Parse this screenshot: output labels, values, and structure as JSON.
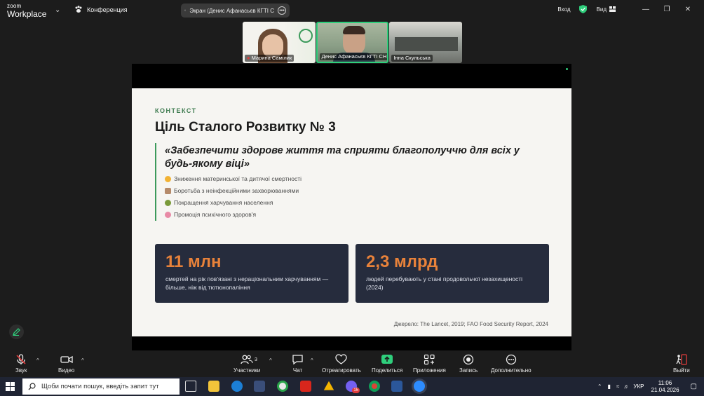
{
  "app": {
    "logo_line1": "zoom",
    "logo_line2": "Workplace",
    "conference_label": "Конференция",
    "screen_share_label": "Экран (Денис Афанасьєв КГТІ С",
    "entry_label": "Вход",
    "view_label": "Вид"
  },
  "participants": [
    {
      "name": "Марина Самілик",
      "muted": true
    },
    {
      "name": "Денис Афанасьєв КГТІ СН...",
      "active": true
    },
    {
      "name": "Інна Скульська"
    }
  ],
  "slide": {
    "kicker": "КОНТЕКСТ",
    "title": "Ціль Сталого Розвитку № 3",
    "quote": "«Забезпечити здорове життя та сприяти благополуччю для всіх у будь-якому віці»",
    "bullets": [
      {
        "text": "Зниження материнської та дитячої смертності",
        "color": "#f2b233"
      },
      {
        "text": "Боротьба з неінфекційними захворюваннями",
        "color": "#b58a6a"
      },
      {
        "text": "Покращення харчування населення",
        "color": "#7a9a3a"
      },
      {
        "text": "Промоція психічного здоров'я",
        "color": "#e88aa6"
      }
    ],
    "stats": [
      {
        "value": "11 млн",
        "desc": "смертей на рік пов'язані з нераціональним харчуванням — більше, ніж від тютюнопаління"
      },
      {
        "value": "2,3 млрд",
        "desc": "людей перебувають у стані продовольчої незахищеності (2024)"
      }
    ],
    "source": "Джерело: The Lancet, 2019; FAO Food Security Report, 2024",
    "accent_color": "#e8823a",
    "card_color": "#262c3d"
  },
  "toolbar": {
    "audio": "Звук",
    "video": "Видео",
    "participants": "Участники",
    "participants_count": "3",
    "chat": "Чат",
    "react": "Отреагировать",
    "share": "Поделиться",
    "apps": "Приложения",
    "record": "Запись",
    "more": "Дополнительно",
    "leave": "Выйти"
  },
  "taskbar": {
    "search_placeholder": "Щоби почати пошук, введіть запит тут",
    "lang": "УКР",
    "time": "11:06",
    "date": "21.04.2026",
    "viber_badge": "15"
  }
}
